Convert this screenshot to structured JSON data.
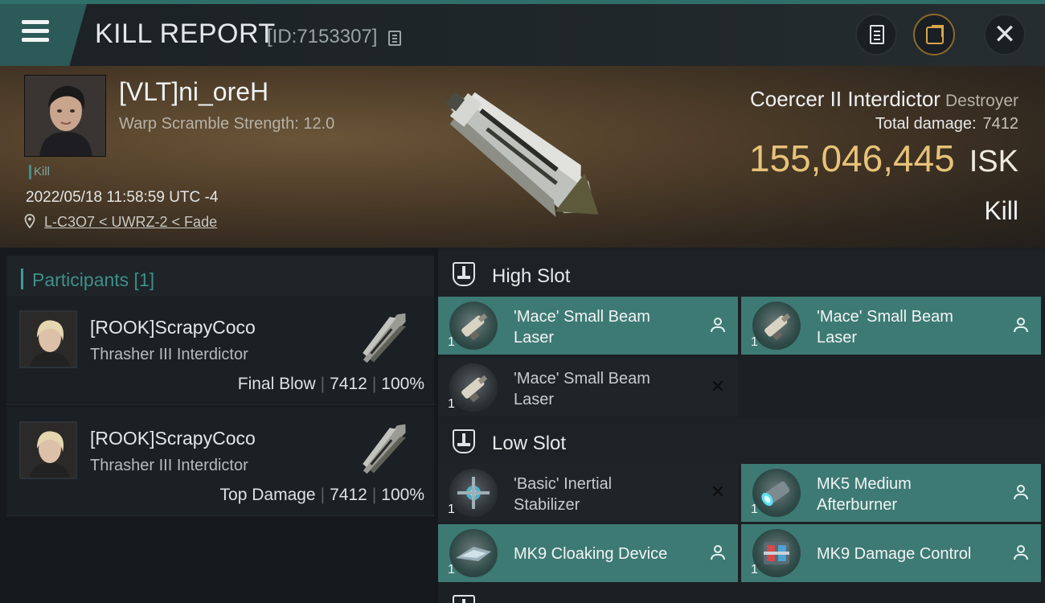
{
  "header": {
    "title": "KILL REPORT",
    "report_id": "[ID:7153307]",
    "icons": {
      "menu": "hamburger-menu-icon",
      "copy": "copy-icon",
      "notes": "notes-icon",
      "share": "share-icon",
      "close": "close-icon"
    },
    "close_glyph": "✕"
  },
  "victim": {
    "name": "[VLT]ni_oreH",
    "stat": "Warp Scramble Strength: 12.0",
    "tag": "Kill",
    "datetime": "2022/05/18 11:58:59 UTC -4",
    "location": "L-C3O7 < UWRZ-2 < Fade",
    "ship_name": "Coercer II Interdictor",
    "ship_class": "Destroyer",
    "total_damage_label": "Total damage:",
    "total_damage": "7412",
    "isk_value": "155,046,445",
    "isk_unit": "ISK",
    "result": "Kill"
  },
  "participants": {
    "title": "Participants [1]",
    "rows": [
      {
        "name": "[ROOK]ScrapyCoco",
        "ship": "Thrasher III Interdictor",
        "role": "Final Blow",
        "damage": "7412",
        "percent": "100%"
      },
      {
        "name": "[ROOK]ScrapyCoco",
        "ship": "Thrasher III Interdictor",
        "role": "Top Damage",
        "damage": "7412",
        "percent": "100%"
      }
    ],
    "separator": "|"
  },
  "slots": {
    "high": {
      "title": "High Slot",
      "modules": [
        {
          "line1": "'Mace' Small Beam",
          "line2": "Laser",
          "qty": "1",
          "state": "dropped",
          "icon": "beam-laser-icon"
        },
        {
          "line1": "'Mace' Small Beam",
          "line2": "Laser",
          "qty": "1",
          "state": "dropped",
          "icon": "beam-laser-icon"
        },
        {
          "line1": "'Mace' Small Beam",
          "line2": "Laser",
          "qty": "1",
          "state": "destroyed",
          "icon": "beam-laser-icon"
        }
      ]
    },
    "low": {
      "title": "Low Slot",
      "modules": [
        {
          "line1": "'Basic' Inertial",
          "line2": "Stabilizer",
          "qty": "1",
          "state": "destroyed",
          "icon": "inertial-stabilizer-icon"
        },
        {
          "line1": "MK5 Medium",
          "line2": "Afterburner",
          "qty": "1",
          "state": "dropped",
          "icon": "afterburner-icon"
        },
        {
          "line1": "MK9 Cloaking Device",
          "line2": "",
          "qty": "1",
          "state": "dropped",
          "icon": "cloaking-device-icon"
        },
        {
          "line1": "MK9 Damage Control",
          "line2": "",
          "qty": "1",
          "state": "dropped",
          "icon": "damage-control-icon"
        }
      ]
    }
  },
  "colors": {
    "accent": "#3e7a74",
    "isk": "#e7c278",
    "participants_title": "#3f8f8a"
  }
}
